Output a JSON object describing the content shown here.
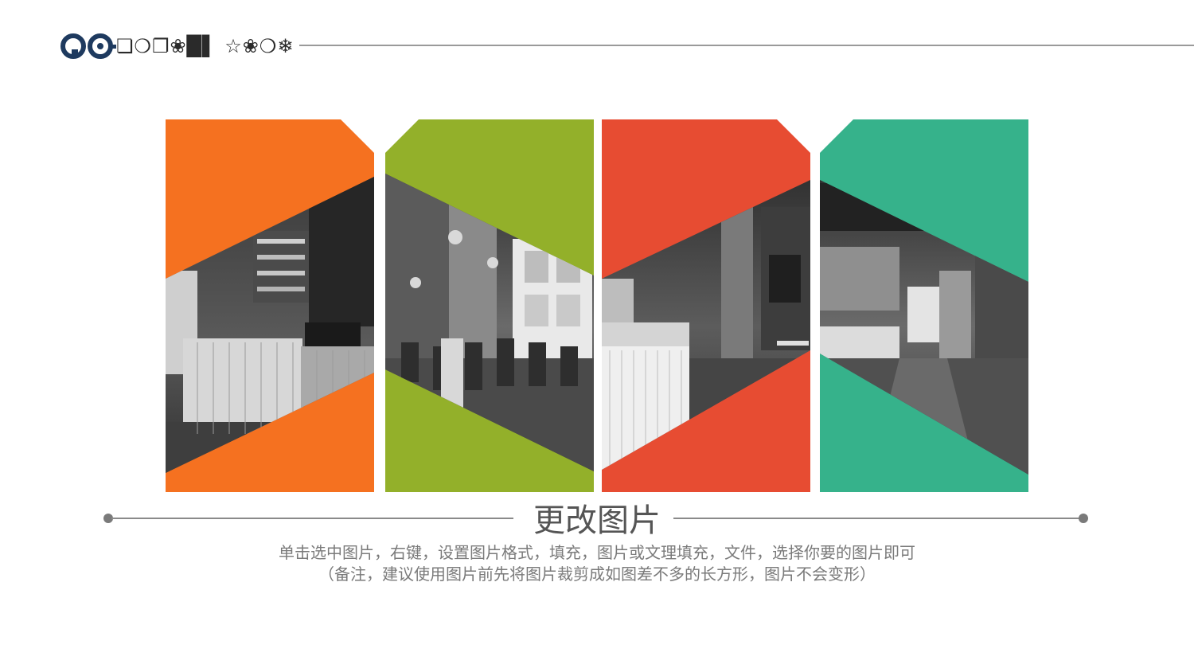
{
  "header": {
    "glyphs": "❏❍❐❀█▌ ☆❀❍❄",
    "colors": {
      "logo": "#1e3a5f",
      "rule": "#9a9a9a"
    }
  },
  "panels": [
    {
      "color": "#f57120"
    },
    {
      "color": "#93b02a"
    },
    {
      "color": "#e74c32"
    },
    {
      "color": "#36b28b"
    }
  ],
  "caption": {
    "title": "更改图片",
    "line1": "单击选中图片，右键，设置图片格式，填充，图片或文理填充，文件，选择你要的图片即可",
    "line2": "（备注，建议使用图片前先将图片裁剪成如图差不多的长方形，图片不会变形）"
  }
}
